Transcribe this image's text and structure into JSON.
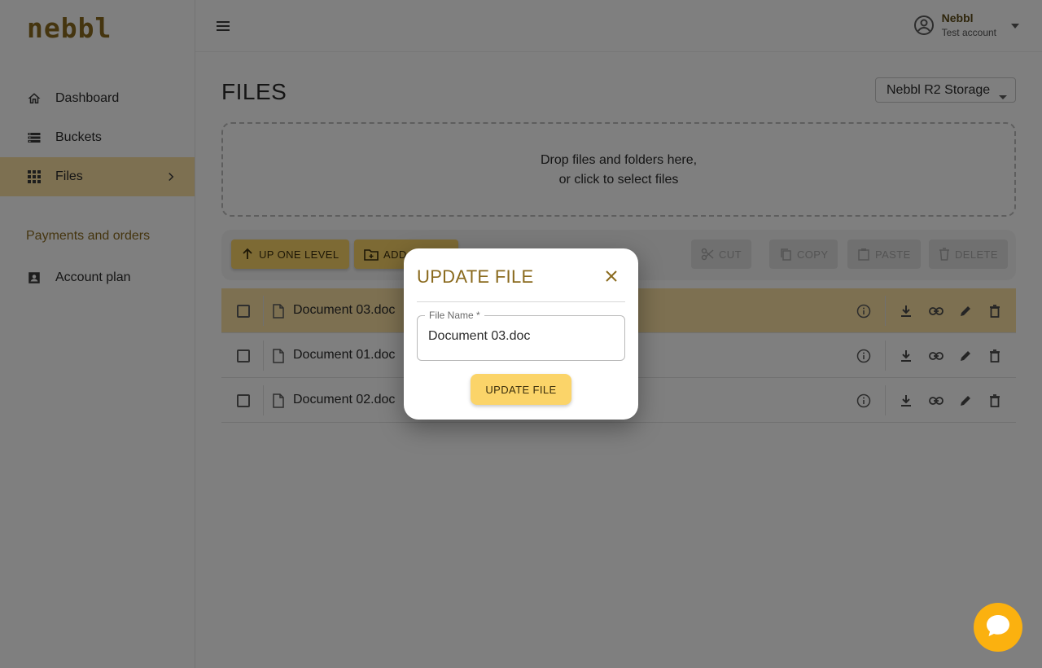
{
  "app": {
    "logo_text": "nebbl"
  },
  "sidebar": {
    "items": [
      {
        "label": "Dashboard",
        "icon": "home-icon"
      },
      {
        "label": "Buckets",
        "icon": "list-icon"
      },
      {
        "label": "Files",
        "icon": "grid-icon",
        "active": true
      }
    ],
    "section_label": "Payments and orders",
    "section_items": [
      {
        "label": "Account plan",
        "icon": "account-box-icon"
      }
    ]
  },
  "topbar": {
    "menu_icon": "menu-icon",
    "user_name": "Nebbl",
    "user_sub": "Test account"
  },
  "main": {
    "title": "FILES",
    "storage_select": "Nebbl R2 Storage",
    "dropzone_line1": "Drop files and folders here,",
    "dropzone_line2": "or click to select files",
    "toolbar": {
      "up_one_level": "UP ONE LEVEL",
      "add_folder": "ADD",
      "cut": "CUT",
      "copy": "COPY",
      "paste": "PASTE",
      "delete": "DELETE"
    },
    "files": [
      {
        "name": "Document 03.doc",
        "selected": true
      },
      {
        "name": "Document 01.doc",
        "selected": false
      },
      {
        "name": "Document 02.doc",
        "selected": false
      }
    ]
  },
  "modal": {
    "title": "UPDATE FILE",
    "field_label": "File Name *",
    "field_value": "Document 03.doc",
    "button": "UPDATE FILE"
  },
  "colors": {
    "accent": "#fbd469",
    "active_bg": "#fbe0a3",
    "brand_text": "#8a6a1e",
    "chat": "#fbb10f"
  }
}
